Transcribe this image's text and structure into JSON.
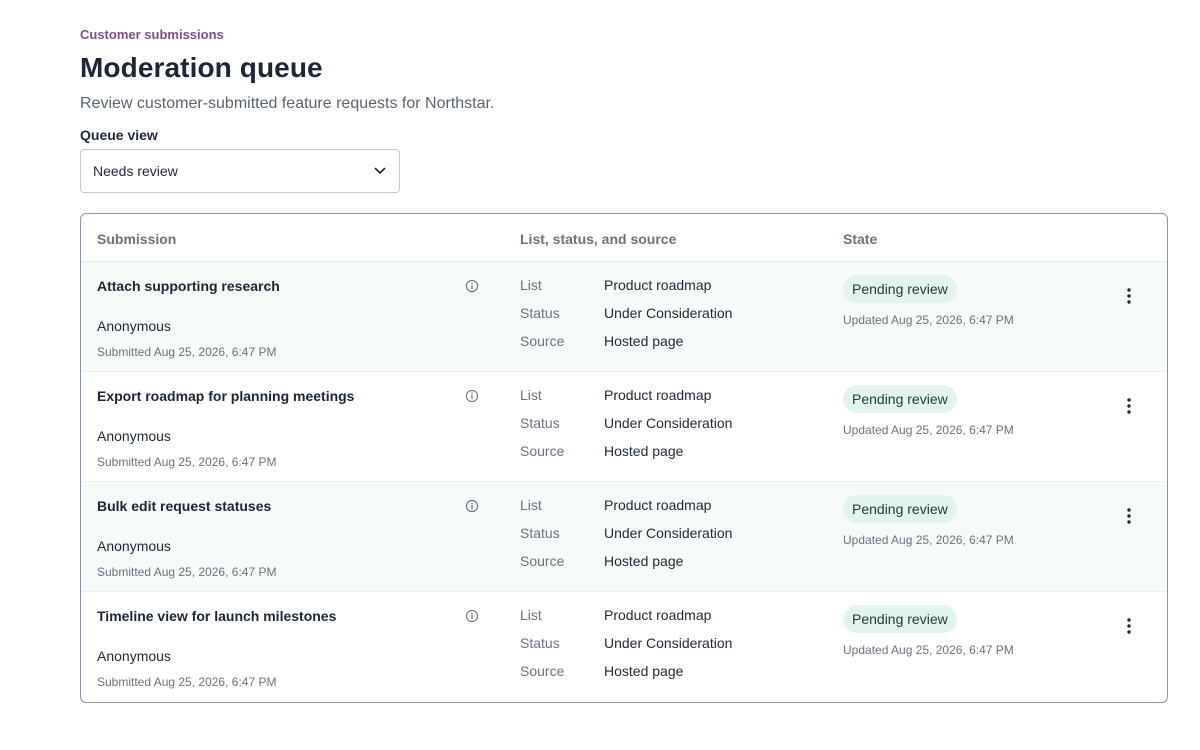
{
  "header": {
    "eyebrow": "Customer submissions",
    "title": "Moderation queue",
    "subtitle": "Review customer-submitted feature requests for Northstar."
  },
  "queue_view": {
    "label": "Queue view",
    "selected": "Needs review"
  },
  "table": {
    "columns": {
      "submission": "Submission",
      "list_status_source": "List, status, and source",
      "state": "State"
    },
    "meta_labels": {
      "list": "List",
      "status": "Status",
      "source": "Source"
    },
    "rows": [
      {
        "title": "Attach supporting research",
        "author": "Anonymous",
        "submitted": "Submitted Aug 25, 2026, 6:47 PM",
        "list": "Product roadmap",
        "status": "Under Consideration",
        "source": "Hosted page",
        "state": "Pending review",
        "updated": "Updated Aug 25, 2026, 6:47 PM"
      },
      {
        "title": "Export roadmap for planning meetings",
        "author": "Anonymous",
        "submitted": "Submitted Aug 25, 2026, 6:47 PM",
        "list": "Product roadmap",
        "status": "Under Consideration",
        "source": "Hosted page",
        "state": "Pending review",
        "updated": "Updated Aug 25, 2026, 6:47 PM"
      },
      {
        "title": "Bulk edit request statuses",
        "author": "Anonymous",
        "submitted": "Submitted Aug 25, 2026, 6:47 PM",
        "list": "Product roadmap",
        "status": "Under Consideration",
        "source": "Hosted page",
        "state": "Pending review",
        "updated": "Updated Aug 25, 2026, 6:47 PM"
      },
      {
        "title": "Timeline view for launch milestones",
        "author": "Anonymous",
        "submitted": "Submitted Aug 25, 2026, 6:47 PM",
        "list": "Product roadmap",
        "status": "Under Consideration",
        "source": "Hosted page",
        "state": "Pending review",
        "updated": "Updated Aug 25, 2026, 6:47 PM"
      }
    ]
  },
  "icons": {
    "select_chevron": "chevron-down-icon",
    "row_info": "info-icon",
    "row_menu": "more-vertical-icon"
  },
  "colors": {
    "eyebrow": "#7a4f93",
    "badge_bg": "#e3f4ec",
    "row_alt_bg": "#f6faf8",
    "table_border": "#8a94a6"
  }
}
